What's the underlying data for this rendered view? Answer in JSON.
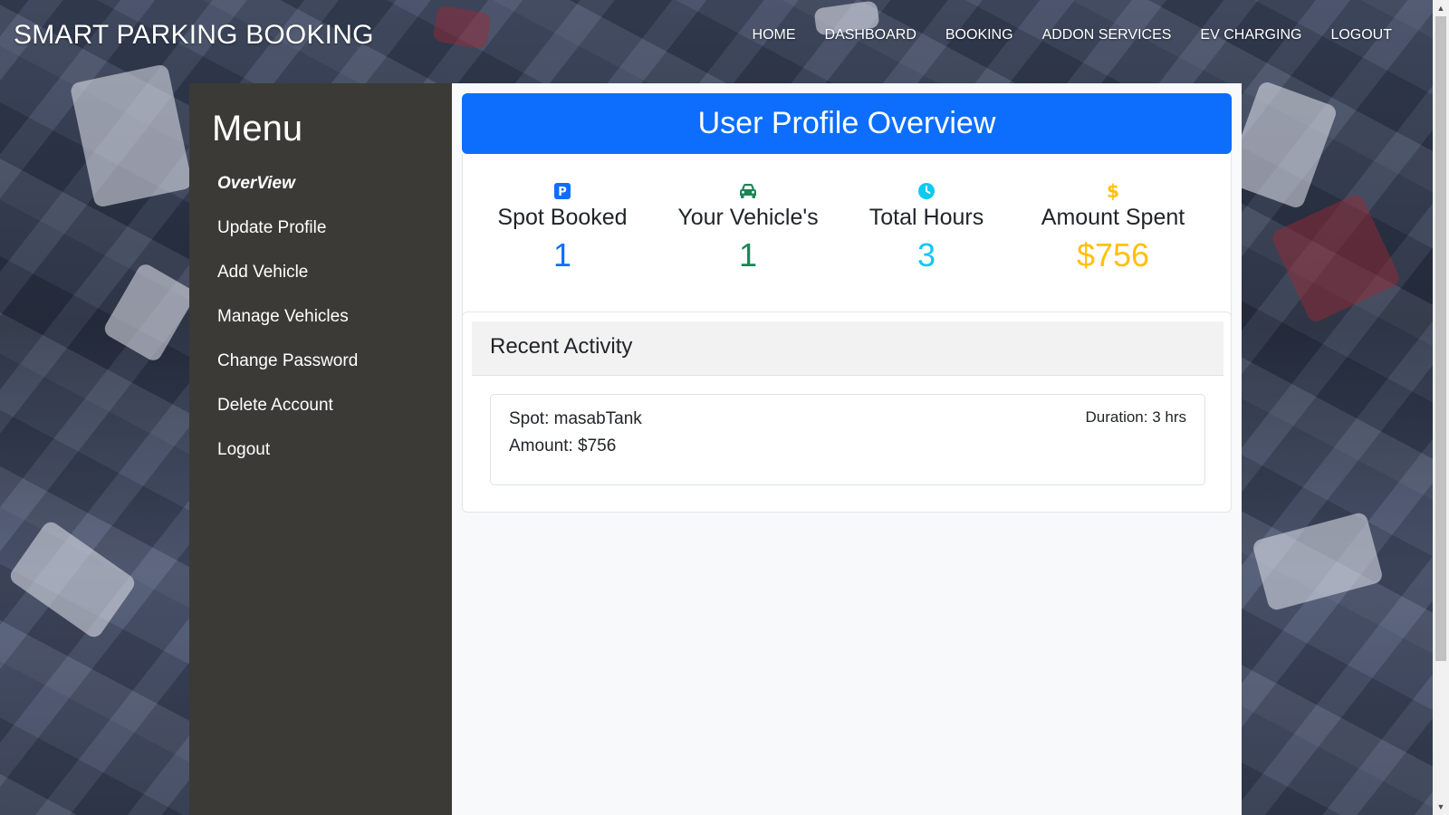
{
  "brand": "SMART PARKING BOOKING",
  "nav": [
    "HOME",
    "DASHBOARD",
    "BOOKING",
    "ADDON SERVICES",
    "EV CHARGING",
    "LOGOUT"
  ],
  "sidebar": {
    "title": "Menu",
    "items": [
      {
        "label": "OverView",
        "active": true
      },
      {
        "label": "Update Profile"
      },
      {
        "label": "Add Vehicle"
      },
      {
        "label": "Manage Vehicles"
      },
      {
        "label": "Change Password"
      },
      {
        "label": "Delete Account"
      },
      {
        "label": "Logout"
      }
    ]
  },
  "main": {
    "title": "User Profile Overview",
    "stats": [
      {
        "icon": "parking-icon",
        "label": "Spot Booked",
        "value": "1",
        "color": "#0d6efd"
      },
      {
        "icon": "car-icon",
        "label": "Your Vehicle's",
        "value": "1",
        "color": "#198754"
      },
      {
        "icon": "clock-icon",
        "label": "Total Hours",
        "value": "3",
        "color": "#0dcaf0"
      },
      {
        "icon": "dollar-icon",
        "label": "Amount Spent",
        "value": "$756",
        "color": "#ffc107"
      }
    ],
    "activity": {
      "title": "Recent Activity",
      "items": [
        {
          "spot": "Spot: masabTank",
          "amount": "Amount: $756",
          "duration": "Duration: 3 hrs"
        }
      ]
    }
  },
  "colors": {
    "primary": "#0d6efd",
    "sidebar_bg": "#3b3a36",
    "main_bg": "#f8f9fa"
  }
}
